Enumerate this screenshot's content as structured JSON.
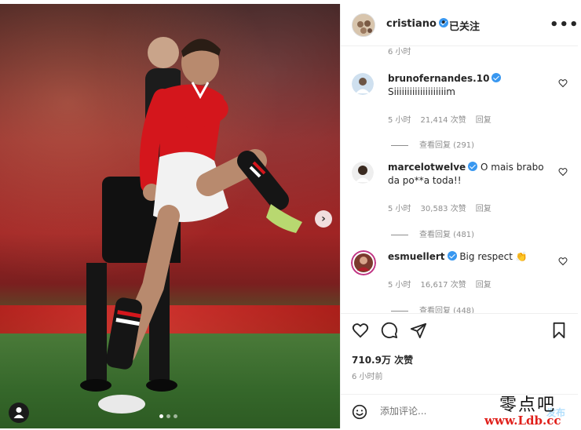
{
  "post": {
    "author": "cristiano",
    "separator": "•",
    "follow_status": "已关注",
    "more_icon": "more-horizontal-icon",
    "first_timestamp": "6 小时",
    "likes": "710.9万 次赞",
    "posted_time": "6 小时前",
    "carousel_dots": 3
  },
  "comments": [
    {
      "user": "brunofernandes.10",
      "text": "Siiiiiiiiiiiiiiiiiiiim",
      "time": "5 小时",
      "likes": "21,414 次赞",
      "reply": "回复",
      "view_replies": "查看回复 (291)"
    },
    {
      "user": "marcelotwelve",
      "text": "O mais brabo da po**a toda!!",
      "time": "5 小时",
      "likes": "30,583 次赞",
      "reply": "回复",
      "view_replies": "查看回复 (481)"
    },
    {
      "user": "esmuellert",
      "text": "Big respect 👏",
      "time": "5 小时",
      "likes": "16,617 次赞",
      "reply": "回复",
      "view_replies": "查看回复 (448)"
    }
  ],
  "composer": {
    "placeholder": "添加评论...",
    "post_label": "发布"
  },
  "watermark": {
    "cn": "零点吧",
    "url": "www.Ldb.cc"
  },
  "colors": {
    "verified": "#3897f0",
    "muted": "#8e8e8e",
    "text": "#262626",
    "watermark_red": "#e0201b"
  }
}
